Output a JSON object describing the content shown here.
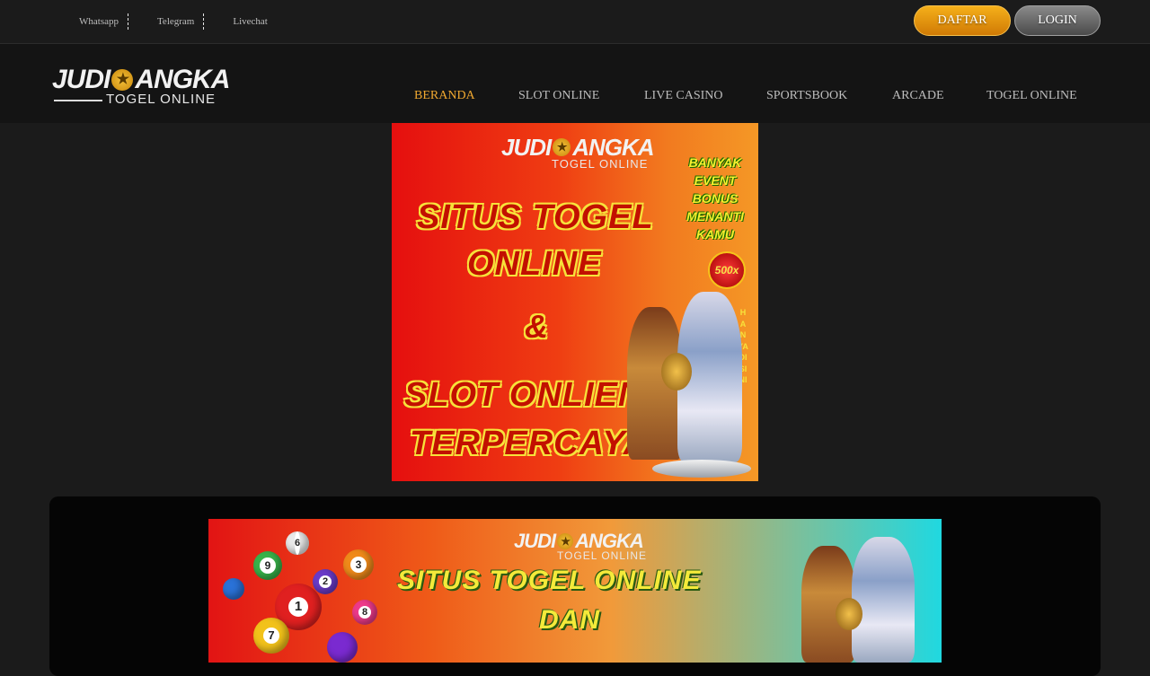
{
  "topbar": {
    "contacts": [
      "Whatsapp",
      "Telegram",
      "Livechat"
    ],
    "daftar_label": "DAFTAR",
    "login_label": "LOGIN"
  },
  "logo": {
    "word1": "JUDI",
    "word2": "ANGKA",
    "tagline": "TOGEL ONLINE"
  },
  "nav": {
    "items": [
      "BERANDA",
      "SLOT ONLINE",
      "LIVE CASINO",
      "SPORTSBOOK",
      "ARCADE",
      "TOGEL ONLINE"
    ],
    "active": "BERANDA"
  },
  "hero": {
    "side_text": [
      "BANYAK",
      "EVENT",
      "BONUS",
      "MENANTI",
      "KAMU"
    ],
    "lines": [
      "SITUS TOGEL",
      "ONLINE",
      "&",
      "SLOT ONLIEN",
      "TERPERCAYA"
    ],
    "badge": "500x",
    "vertical": "HANYA DISINI"
  },
  "banner2": {
    "line1": "SITUS TOGEL ONLINE",
    "line2": "DAN",
    "balls": [
      "6",
      "9",
      "3",
      "2",
      "1",
      "8",
      "7"
    ]
  },
  "colors": {
    "accent": "#f0a830",
    "background": "#1b1b1b",
    "header": "#141414"
  }
}
